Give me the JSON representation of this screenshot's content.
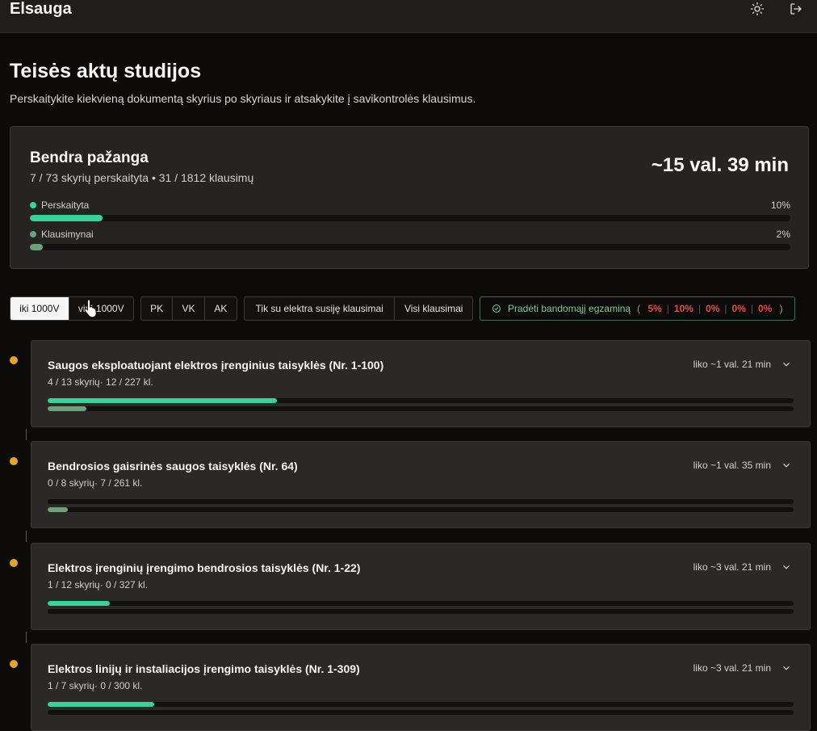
{
  "app": {
    "title": "Elsauga"
  },
  "header": {
    "title": "Teisės aktų studijos",
    "subtitle": "Perskaitykite kiekvieną dokumentą skyrius po skyriaus ir atsakykite į savikontrolės klausimus."
  },
  "overall": {
    "title": "Bendra pažanga",
    "stats": "7 / 73 skyrių perskaityta • 31 / 1812 klausimų",
    "time_left": "~15 val. 39 min",
    "read_label": "Perskaityta",
    "read_pct_text": "10%",
    "read_fraction": 0.096,
    "questions_label": "Klausimynai",
    "questions_pct_text": "2%",
    "questions_fraction": 0.017,
    "read_color": "#36d39a",
    "questions_color": "#6fa07c"
  },
  "filters": {
    "voltage": [
      "iki 1000V",
      "virš 1000V"
    ],
    "voltage_active": 0,
    "category": [
      "PK",
      "VK",
      "AK"
    ],
    "question_scope": [
      "Tik su elektra susiję klausimai",
      "Visi klausimai"
    ]
  },
  "exam": {
    "label": "Pradėti bandomąjį egzaminą",
    "open_paren": "(",
    "close_paren": ")",
    "scores": [
      "5%",
      "10%",
      "0%",
      "0%",
      "0%"
    ]
  },
  "documents": [
    {
      "title": "Saugos eksploatuojant elektros įrenginius taisyklės (Nr. 1-100)",
      "stats": "4 / 13 skyrių· 12 / 227 kl.",
      "time_left": "liko ~1 val. 21 min",
      "read_fraction": 0.307,
      "questions_fraction": 0.052
    },
    {
      "title": "Bendrosios gaisrinės saugos taisyklės (Nr. 64)",
      "stats": "0 / 8 skyrių· 7 / 261 kl.",
      "time_left": "liko ~1 val. 35 min",
      "read_fraction": 0.0,
      "questions_fraction": 0.027
    },
    {
      "title": "Elektros įrenginių įrengimo bendrosios taisyklės (Nr. 1-22)",
      "stats": "1 / 12 skyrių· 0 / 327 kl.",
      "time_left": "liko ~3 val. 21 min",
      "read_fraction": 0.083,
      "questions_fraction": 0.0
    },
    {
      "title": "Elektros linijų ir instaliacijos įrengimo taisyklės (Nr. 1-309)",
      "stats": "1 / 7 skyrių· 0 / 300 kl.",
      "time_left": "liko ~3 val. 21 min",
      "read_fraction": 0.143,
      "questions_fraction": 0.0
    }
  ],
  "icons": {
    "theme": "sun-icon",
    "logout": "logout-icon",
    "expand": "chevron-down-icon",
    "exam": "check-circle-icon",
    "pointer": "hand-pointer-icon"
  },
  "colors": {
    "accent_read": "#36d39a",
    "accent_questions": "#6fa07c",
    "timeline_dot": "#e2a62a",
    "exam_text": "#7fc99a",
    "exam_score": "#e24b4b"
  }
}
